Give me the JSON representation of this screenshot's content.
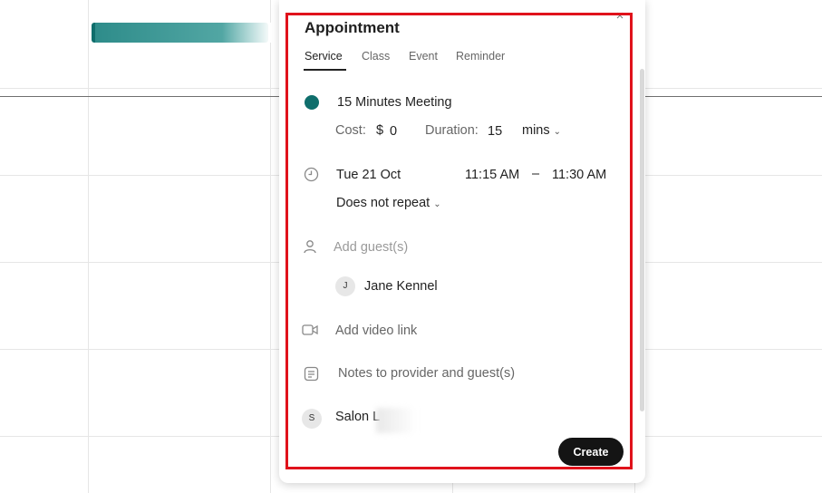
{
  "dialog": {
    "title": "Appointment",
    "tabs": [
      {
        "label": "Service",
        "active": true
      },
      {
        "label": "Class"
      },
      {
        "label": "Event"
      },
      {
        "label": "Reminder"
      }
    ],
    "service": {
      "name": "15 Minutes Meeting",
      "color": "#0f6e6c",
      "cost_label": "Cost:",
      "currency": "$",
      "cost_value": "0",
      "duration_label": "Duration:",
      "duration_value": "15",
      "duration_unit": "mins"
    },
    "datetime": {
      "date": "Tue 21 Oct",
      "start": "11:15 AM",
      "separator": "–",
      "end": "11:30 AM",
      "repeat": "Does not repeat"
    },
    "guests": {
      "placeholder": "Add guest(s)",
      "list": [
        {
          "initial": "J",
          "name": "Jane Kennel"
        }
      ]
    },
    "video": {
      "label": "Add video link"
    },
    "notes": {
      "placeholder": "Notes to provider and guest(s)"
    },
    "provider": {
      "initial": "S",
      "name": "Salon L"
    },
    "create_label": "Create",
    "close_label": "×"
  },
  "colors": {
    "accent": "#0f6e6c",
    "highlight": "#e0121b",
    "button": "#141414"
  }
}
